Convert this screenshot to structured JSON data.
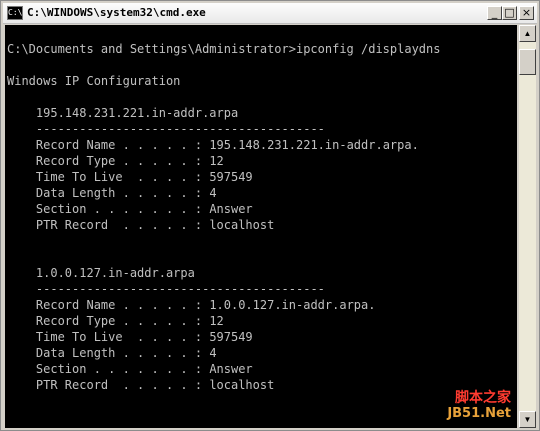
{
  "window": {
    "title": "C:\\WINDOWS\\system32\\cmd.exe",
    "icon_label": "C:\\",
    "minimize_label": "_",
    "maximize_label": "□",
    "close_label": "×"
  },
  "console": {
    "prompt": "C:\\Documents and Settings\\Administrator>ipconfig /displaydns",
    "header": "Windows IP Configuration",
    "entries": [
      {
        "name": "195.148.231.221.in-addr.arpa",
        "separator": "----------------------------------------",
        "fields": [
          {
            "label": "Record Name . . . . . :",
            "value": "195.148.231.221.in-addr.arpa."
          },
          {
            "label": "Record Type . . . . . :",
            "value": "12"
          },
          {
            "label": "Time To Live  . . . . :",
            "value": "597549"
          },
          {
            "label": "Data Length . . . . . :",
            "value": "4"
          },
          {
            "label": "Section . . . . . . . :",
            "value": "Answer"
          },
          {
            "label": "PTR Record  . . . . . :",
            "value": "localhost"
          }
        ]
      },
      {
        "name": "1.0.0.127.in-addr.arpa",
        "separator": "----------------------------------------",
        "fields": [
          {
            "label": "Record Name . . . . . :",
            "value": "1.0.0.127.in-addr.arpa."
          },
          {
            "label": "Record Type . . . . . :",
            "value": "12"
          },
          {
            "label": "Time To Live  . . . . :",
            "value": "597549"
          },
          {
            "label": "Data Length . . . . . :",
            "value": "4"
          },
          {
            "label": "Section . . . . . . . :",
            "value": "Answer"
          },
          {
            "label": "PTR Record  . . . . . :",
            "value": "localhost"
          }
        ]
      }
    ]
  },
  "scrollbar": {
    "up_arrow": "▲",
    "down_arrow": "▼"
  },
  "watermark": {
    "chinese": "脚本之家",
    "site": "JB51.Net"
  },
  "colors": {
    "console_bg": "#000000",
    "console_text": "#c0c0c0",
    "watermark_red": "#ff3b30",
    "watermark_orange": "#e8a23a"
  }
}
